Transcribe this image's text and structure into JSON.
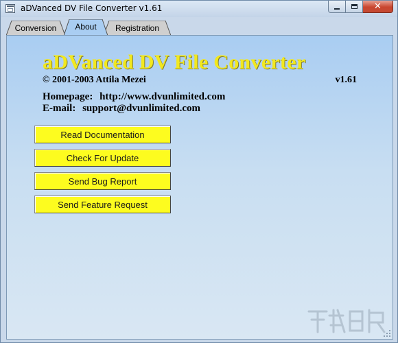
{
  "window": {
    "title": "aDVanced DV File Converter v1.61",
    "icons": [
      "app-icon",
      "minimize-icon",
      "maximize-icon",
      "close-icon"
    ]
  },
  "tabs": [
    {
      "label": "Conversion",
      "active": false
    },
    {
      "label": "About",
      "active": true
    },
    {
      "label": "Registration",
      "active": false
    }
  ],
  "about": {
    "app_title": "aDVanced DV File Converter",
    "copyright": "© 2001-2003 Attila Mezei",
    "version": "v1.61",
    "homepage_label": "Homepage:",
    "homepage_value": "http://www.dvunlimited.com",
    "email_label": "E-mail:",
    "email_value": "support@dvunlimited.com"
  },
  "buttons": {
    "read_docs": "Read Documentation",
    "check_update": "Check For Update",
    "bug_report": "Send Bug Report",
    "feature_request": "Send Feature Request"
  },
  "colors": {
    "panel_top": "#a9cdf2",
    "panel_bottom": "#d9e7f3",
    "title_yellow": "#f2e81e",
    "button_yellow": "#fdfc1f",
    "close_red": "#c9462f"
  }
}
